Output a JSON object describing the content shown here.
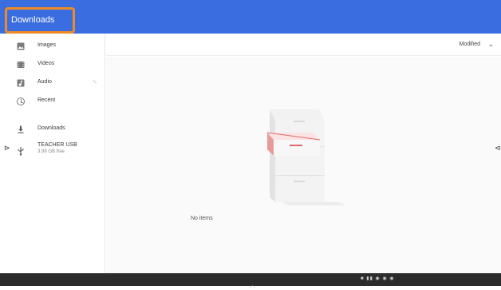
{
  "header": {
    "title": "Downloads"
  },
  "sidebar": {
    "items": [
      {
        "label": "Images",
        "icon": "image-icon"
      },
      {
        "label": "Videos",
        "icon": "video-icon"
      },
      {
        "label": "Audio",
        "icon": "audio-icon"
      },
      {
        "label": "Recent",
        "icon": "clock-icon"
      },
      {
        "label": "Downloads",
        "icon": "download-icon"
      },
      {
        "label": "TEACHER USB",
        "sublabel": "3.99 GB free",
        "icon": "usb-icon"
      }
    ]
  },
  "toolbar": {
    "sort_label": "Modified"
  },
  "main": {
    "empty_text": "No items"
  },
  "colors": {
    "header_bg": "#3a6ee0",
    "highlight_border": "#f08a24",
    "shelf_bg": "#2b2b2b",
    "drawer_accent": "#e06a6a"
  }
}
